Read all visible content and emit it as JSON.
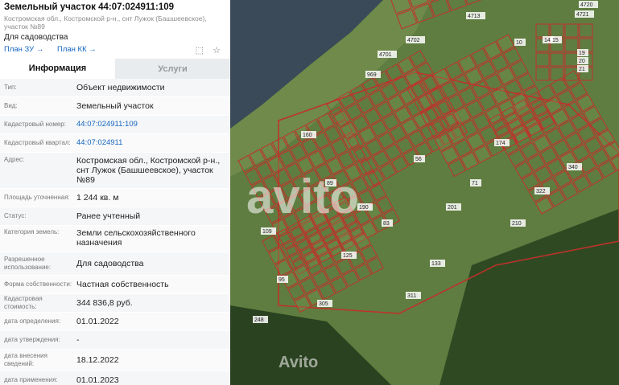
{
  "parcel": {
    "title": "Земельный участок 44:07:024911:109",
    "address_short": "Костромская обл., Костромской р-н., снт Лужок (Башшеевское), участок №89",
    "purpose": "Для садоводства",
    "plan_zu": "План ЗУ",
    "plan_kk": "План КК"
  },
  "tabs": [
    {
      "label": "Информация"
    },
    {
      "label": "Услуги"
    }
  ],
  "details": [
    {
      "label": "Тип:",
      "value": "Объект недвижимости"
    },
    {
      "label": "Вид:",
      "value": "Земельный участок"
    },
    {
      "label": "Кадастровый номер:",
      "value": "44:07:024911:109"
    },
    {
      "label": "Кадастровый квартал:",
      "value": "44:07:024911"
    },
    {
      "label": "Адрес:",
      "value": "Костромская обл., Костромской р-н., снт Лужок (Башшеевское), участок №89"
    },
    {
      "label": "Площадь уточненная:",
      "value": "1 244 кв. м"
    },
    {
      "label": "Статус:",
      "value": "Ранее учтенный"
    },
    {
      "label": "Категория земель:",
      "value": "Земли сельскохозяйственного назначения"
    },
    {
      "label": "Разрешенное использование:",
      "value": "Для садоводства"
    },
    {
      "label": "Форма собственности:",
      "value": "Частная собственность"
    },
    {
      "label": "Кадастровая стоимость:",
      "value": "344 836,8 руб."
    },
    {
      "label": "дата определения:",
      "value": "01.01.2022"
    },
    {
      "label": "дата утверждения:",
      "value": "-"
    },
    {
      "label": "дата внесения сведений:",
      "value": "18.12.2022"
    },
    {
      "label": "дата применения:",
      "value": "01.01.2023"
    }
  ],
  "map": {
    "plot_labels": [
      "4721",
      "4720",
      "4713",
      "4702",
      "4701",
      "969",
      "10",
      "14",
      "15",
      "19",
      "20",
      "21",
      "89",
      "109",
      "56",
      "71",
      "83",
      "95",
      "125",
      "133",
      "160",
      "174",
      "190",
      "201",
      "210",
      "248",
      "305",
      "311",
      "322",
      "340"
    ],
    "watermark": "avito",
    "watermark_bottom": "Avito",
    "colors": {
      "water": "#3b4a58",
      "forest": "#2f4a22",
      "field": "#6f8a4a",
      "boundary": "#c0312b"
    }
  }
}
